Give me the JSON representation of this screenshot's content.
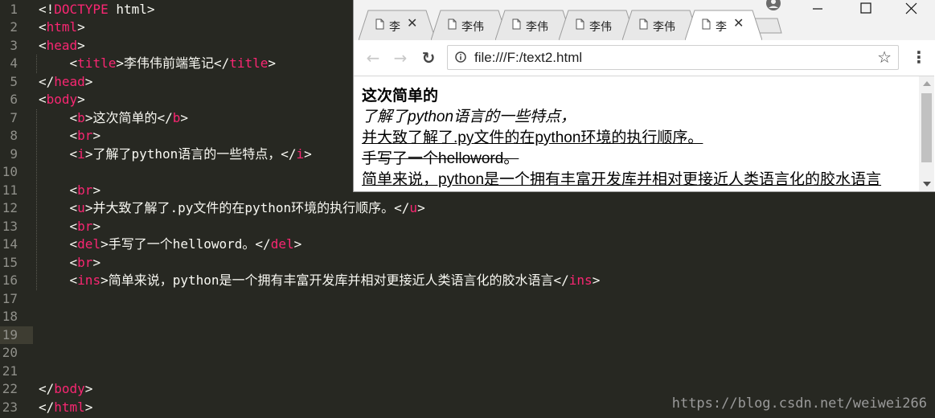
{
  "editor": {
    "lines": [
      {
        "n": "1",
        "parts": [
          {
            "t": "txt",
            "v": "<!"
          },
          {
            "t": "kw",
            "v": "DOCTYPE"
          },
          {
            "t": "txt",
            "v": " html>"
          }
        ]
      },
      {
        "n": "2",
        "parts": [
          {
            "t": "txt",
            "v": "<"
          },
          {
            "t": "tag",
            "v": "html"
          },
          {
            "t": "txt",
            "v": ">"
          }
        ]
      },
      {
        "n": "3",
        "parts": [
          {
            "t": "txt",
            "v": "<"
          },
          {
            "t": "tag",
            "v": "head"
          },
          {
            "t": "txt",
            "v": ">"
          }
        ]
      },
      {
        "n": "4",
        "parts": [
          {
            "t": "txt",
            "v": "    <"
          },
          {
            "t": "tag",
            "v": "title"
          },
          {
            "t": "txt",
            "v": ">李伟伟前端笔记</"
          },
          {
            "t": "tag",
            "v": "title"
          },
          {
            "t": "txt",
            "v": ">"
          }
        ]
      },
      {
        "n": "5",
        "parts": [
          {
            "t": "txt",
            "v": "</"
          },
          {
            "t": "tag",
            "v": "head"
          },
          {
            "t": "txt",
            "v": ">"
          }
        ]
      },
      {
        "n": "6",
        "parts": [
          {
            "t": "txt",
            "v": "<"
          },
          {
            "t": "tag",
            "v": "body"
          },
          {
            "t": "txt",
            "v": ">"
          }
        ]
      },
      {
        "n": "7",
        "parts": [
          {
            "t": "txt",
            "v": "    <"
          },
          {
            "t": "tag",
            "v": "b"
          },
          {
            "t": "txt",
            "v": ">这次简单的</"
          },
          {
            "t": "tag",
            "v": "b"
          },
          {
            "t": "txt",
            "v": ">"
          }
        ]
      },
      {
        "n": "8",
        "parts": [
          {
            "t": "txt",
            "v": "    <"
          },
          {
            "t": "tag",
            "v": "br"
          },
          {
            "t": "txt",
            "v": ">"
          }
        ]
      },
      {
        "n": "9",
        "parts": [
          {
            "t": "txt",
            "v": "    <"
          },
          {
            "t": "tag",
            "v": "i"
          },
          {
            "t": "txt",
            "v": ">了解了python语言的一些特点，</"
          },
          {
            "t": "tag",
            "v": "i"
          },
          {
            "t": "txt",
            "v": ">"
          }
        ]
      },
      {
        "n": "10",
        "parts": []
      },
      {
        "n": "11",
        "parts": [
          {
            "t": "txt",
            "v": "    <"
          },
          {
            "t": "tag",
            "v": "br"
          },
          {
            "t": "txt",
            "v": ">"
          }
        ]
      },
      {
        "n": "12",
        "parts": [
          {
            "t": "txt",
            "v": "    <"
          },
          {
            "t": "tag",
            "v": "u"
          },
          {
            "t": "txt",
            "v": ">并大致了解了.py文件的在python环境的执行顺序。</"
          },
          {
            "t": "tag",
            "v": "u"
          },
          {
            "t": "txt",
            "v": ">"
          }
        ]
      },
      {
        "n": "13",
        "parts": [
          {
            "t": "txt",
            "v": "    <"
          },
          {
            "t": "tag",
            "v": "br"
          },
          {
            "t": "txt",
            "v": ">"
          }
        ]
      },
      {
        "n": "14",
        "parts": [
          {
            "t": "txt",
            "v": "    <"
          },
          {
            "t": "tag",
            "v": "del"
          },
          {
            "t": "txt",
            "v": ">手写了一个helloword。</"
          },
          {
            "t": "tag",
            "v": "del"
          },
          {
            "t": "txt",
            "v": ">"
          }
        ]
      },
      {
        "n": "15",
        "parts": [
          {
            "t": "txt",
            "v": "    <"
          },
          {
            "t": "tag",
            "v": "br"
          },
          {
            "t": "txt",
            "v": ">"
          }
        ]
      },
      {
        "n": "16",
        "parts": [
          {
            "t": "txt",
            "v": "    <"
          },
          {
            "t": "tag",
            "v": "ins"
          },
          {
            "t": "txt",
            "v": ">简单来说，python是一个拥有丰富开发库并相对更接近人类语言化的胶水语言</"
          },
          {
            "t": "tag",
            "v": "ins"
          },
          {
            "t": "txt",
            "v": ">"
          }
        ]
      },
      {
        "n": "17",
        "parts": []
      },
      {
        "n": "18",
        "parts": []
      },
      {
        "n": "19",
        "parts": []
      },
      {
        "n": "20",
        "parts": []
      },
      {
        "n": "21",
        "parts": []
      },
      {
        "n": "22",
        "parts": [
          {
            "t": "txt",
            "v": "</"
          },
          {
            "t": "tag",
            "v": "body"
          },
          {
            "t": "txt",
            "v": ">"
          }
        ]
      },
      {
        "n": "23",
        "parts": [
          {
            "t": "txt",
            "v": "</"
          },
          {
            "t": "tag",
            "v": "html"
          },
          {
            "t": "txt",
            "v": ">"
          }
        ]
      }
    ],
    "current_line": "19",
    "colors": {
      "background": "#272822",
      "tag": "#f92672",
      "text": "#f8f8f2",
      "line_number": "#90908a"
    }
  },
  "browser": {
    "tabs": [
      {
        "label": "李",
        "close": "✕",
        "active": false
      },
      {
        "label": "李伟",
        "close": "",
        "active": false
      },
      {
        "label": "李伟",
        "close": "",
        "active": false
      },
      {
        "label": "李伟",
        "close": "",
        "active": false
      },
      {
        "label": "李伟",
        "close": "",
        "active": false
      },
      {
        "label": "李",
        "close": "✕",
        "active": true
      }
    ],
    "nav": {
      "back": "←",
      "forward": "→",
      "reload": "↻"
    },
    "url": "file:///F:/text2.html",
    "star_icon": "☆",
    "menu_icon": "⋮",
    "content": {
      "bold": "这次简单的",
      "italic": "了解了python语言的一些特点，",
      "underline": "并大致了解了.py文件的在python环境的执行顺序。",
      "deleted": "手写了一个helloword。",
      "inserted": "简单来说，python是一个拥有丰富开发库并相对更接近人类语言化的胶水语言"
    }
  },
  "watermark": "https://blog.csdn.net/weiwei266"
}
